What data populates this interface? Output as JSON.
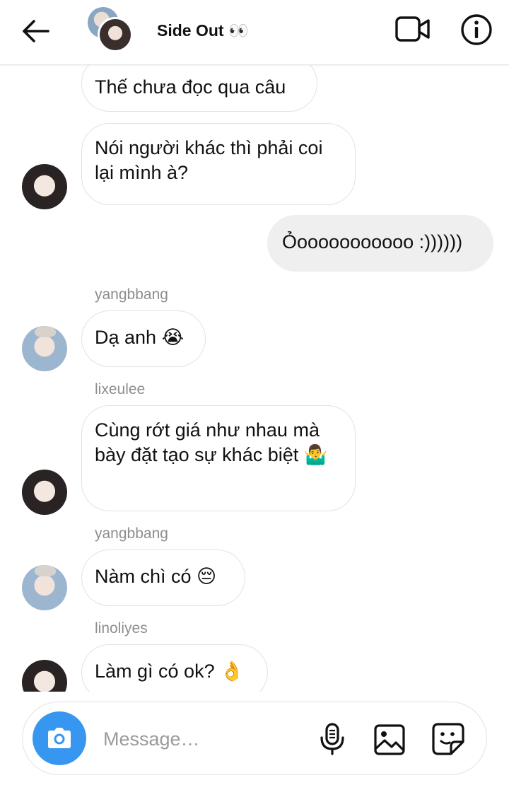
{
  "header": {
    "title": "Side Out 👀"
  },
  "messages": [
    {
      "text": "Thế chưa đọc qua câu"
    },
    {
      "text": "Nói người khác thì phải coi lại mình à?"
    },
    {
      "text": "Ỏooooooooooo :))))))",
      "own": true
    },
    {
      "sender": "yangbbang",
      "text": "Dạ anh 😭"
    },
    {
      "sender": "lixeulee",
      "text": "Cùng rớt giá như nhau mà bày đặt tạo sự khác biệt 🤷‍♂️"
    },
    {
      "sender": "yangbbang",
      "text": "Nàm chì có 😔"
    },
    {
      "sender": "linoliyes",
      "text": "Làm gì có ok? 👌"
    }
  ],
  "composer": {
    "placeholder": "Message…"
  },
  "colors": {
    "accent": "#3797f0",
    "own_bubble": "#efefef",
    "sender_label": "#8e8e8e"
  },
  "icons": [
    "back-arrow-icon",
    "video-call-icon",
    "info-icon",
    "camera-icon",
    "microphone-icon",
    "gallery-icon",
    "sticker-icon"
  ]
}
